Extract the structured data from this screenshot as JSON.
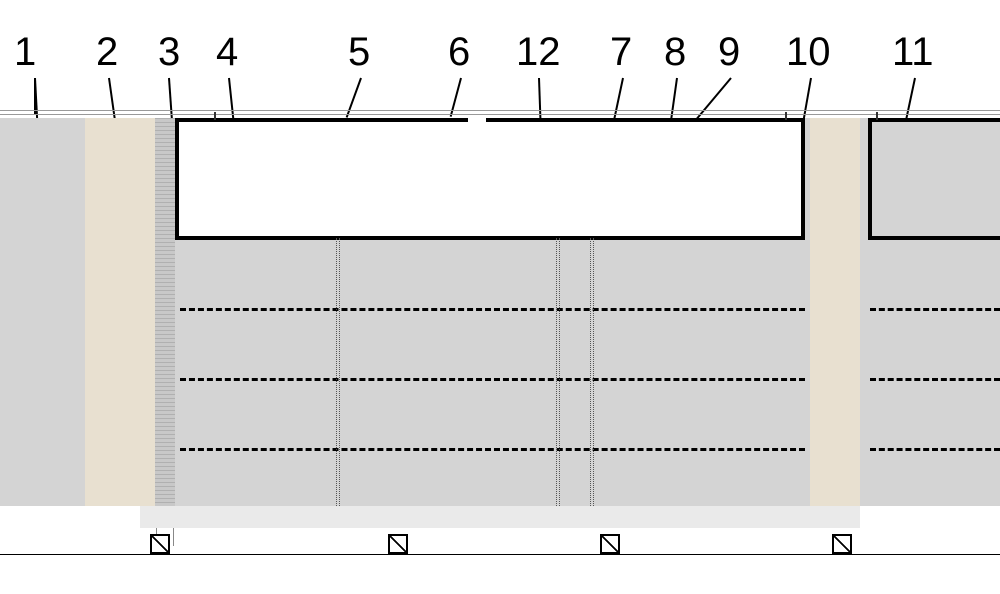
{
  "labels": {
    "l1": "1",
    "l2": "2",
    "l3": "3",
    "l4": "4",
    "l5": "5",
    "l6": "6",
    "l12": "12",
    "l7": "7",
    "l8": "8",
    "l9": "9",
    "l10": "10",
    "l11": "11"
  },
  "chart_data": {
    "type": "diagram",
    "description": "Technical cross-section schematic with 12 numbered callouts",
    "callouts": [
      {
        "n": 1,
        "target": "left-solid-block"
      },
      {
        "n": 2,
        "target": "second-light-column"
      },
      {
        "n": 3,
        "target": "hatched-vertical-strip"
      },
      {
        "n": 4,
        "target": "gray-fill-below-chamber"
      },
      {
        "n": 5,
        "target": "chamber-top-border"
      },
      {
        "n": 6,
        "target": "chamber-top-gap-left"
      },
      {
        "n": 12,
        "target": "pipe-to-bottom"
      },
      {
        "n": 7,
        "target": "chamber-interior"
      },
      {
        "n": 8,
        "target": "chamber-bottom-border"
      },
      {
        "n": 9,
        "target": "chamber-right-wall"
      },
      {
        "n": 10,
        "target": "right-beige-column"
      },
      {
        "n": 11,
        "target": "right-gray-filled-chamber"
      }
    ],
    "dashed_rows": 3,
    "footer_squares": 4
  }
}
